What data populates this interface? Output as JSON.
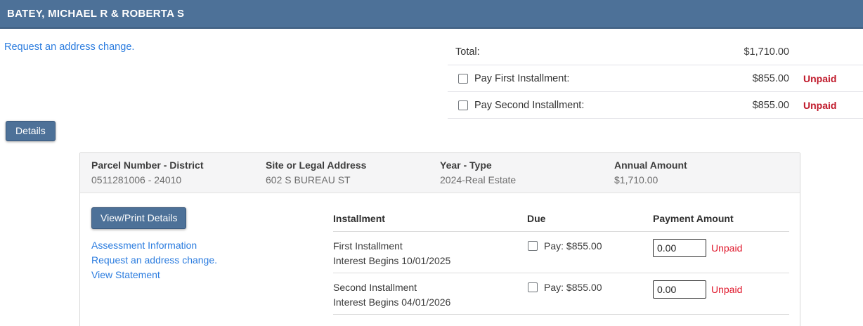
{
  "header": {
    "title": "BATEY, MICHAEL R & ROBERTA S"
  },
  "top_link": "Request an address change.",
  "totals": {
    "total_label": "Total:",
    "total_amount": "$1,710.00",
    "rows": [
      {
        "label": "Pay First Installment:",
        "amount": "$855.00",
        "status": "Unpaid"
      },
      {
        "label": "Pay Second Installment:",
        "amount": "$855.00",
        "status": "Unpaid"
      }
    ]
  },
  "details_button": "Details",
  "panel": {
    "summary": [
      {
        "label": "Parcel Number - District",
        "value": "0511281006 - 24010"
      },
      {
        "label": "Site or Legal Address",
        "value": "602 S BUREAU ST"
      },
      {
        "label": "Year - Type",
        "value": "2024-Real Estate"
      },
      {
        "label": "Annual Amount",
        "value": "$1,710.00"
      }
    ],
    "view_print_button": "View/Print Details",
    "links": [
      "Assessment Information",
      "Request an address change.",
      "View Statement"
    ],
    "table": {
      "headers": [
        "Installment",
        "Due",
        "Payment Amount"
      ],
      "rows": [
        {
          "name": "First Installment",
          "interest": "Interest Begins 10/01/2025",
          "due": "Pay: $855.00",
          "payment_value": "0.00",
          "status": "Unpaid"
        },
        {
          "name": "Second Installment",
          "interest": "Interest Begins 04/01/2026",
          "due": "Pay: $855.00",
          "payment_value": "0.00",
          "status": "Unpaid"
        }
      ]
    }
  },
  "colors": {
    "header_blue": "#4d7198",
    "header_border": "#3f5e80",
    "link_blue": "#2b7cdf",
    "unpaid_red_bold": "#c01a2b",
    "unpaid_red": "#e0192d",
    "panel_header_bg": "#f5f5f6"
  }
}
